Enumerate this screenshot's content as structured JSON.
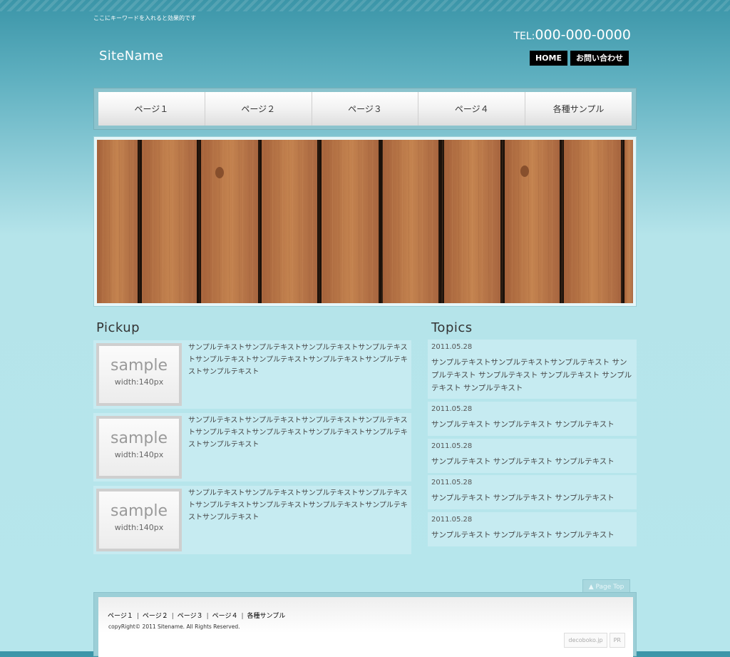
{
  "header": {
    "tagline": "ここにキーワードを入れると効果的です",
    "tel_prefix": "TEL:",
    "tel_number": "000-000-0000",
    "site_name": "SiteName",
    "top_nav": [
      "HOME",
      "お問い合わせ"
    ]
  },
  "global_nav": [
    "ページ１",
    "ページ２",
    "ページ３",
    "ページ４",
    "各種サンプル"
  ],
  "pickup": {
    "title": "Pickup",
    "items": [
      {
        "img_label": "sample",
        "img_sub": "width:140px",
        "text": "サンプルテキストサンプルテキストサンプルテキストサンプルテキストサンプルテキストサンプルテキストサンプルテキストサンプルテキストサンプルテキスト"
      },
      {
        "img_label": "sample",
        "img_sub": "width:140px",
        "text": "サンプルテキストサンプルテキストサンプルテキストサンプルテキストサンプルテキストサンプルテキストサンプルテキストサンプルテキストサンプルテキスト"
      },
      {
        "img_label": "sample",
        "img_sub": "width:140px",
        "text": "サンプルテキストサンプルテキストサンプルテキストサンプルテキストサンプルテキストサンプルテキストサンプルテキストサンプルテキストサンプルテキスト"
      }
    ]
  },
  "topics": {
    "title": "Topics",
    "items": [
      {
        "date": "2011.05.28",
        "text": "サンプルテキストサンプルテキストサンプルテキスト サンプルテキスト サンプルテキスト サンプルテキスト サンプルテキスト サンプルテキスト"
      },
      {
        "date": "2011.05.28",
        "text": "サンプルテキスト サンプルテキスト サンプルテキスト"
      },
      {
        "date": "2011.05.28",
        "text": "サンプルテキスト サンプルテキスト サンプルテキスト"
      },
      {
        "date": "2011.05.28",
        "text": "サンプルテキスト サンプルテキスト サンプルテキスト"
      },
      {
        "date": "2011.05.28",
        "text": "サンプルテキスト サンプルテキスト サンプルテキスト"
      }
    ]
  },
  "page_top": "▲ Page Top",
  "footer": {
    "links": [
      "ページ１",
      "ページ２",
      "ページ３",
      "ページ４",
      "各種サンプル"
    ],
    "separator": "|",
    "copyright": "copyRight© 2011 Sitename. All Rights Reserved.",
    "credit": [
      "decoboko.jp",
      "PR"
    ]
  },
  "colors": {
    "bg_top": "#3b95a8",
    "bg_bottom": "#b6e6ec",
    "panel": "#c6ebf1",
    "nav_button": "#000000",
    "wood": "#b87444"
  }
}
